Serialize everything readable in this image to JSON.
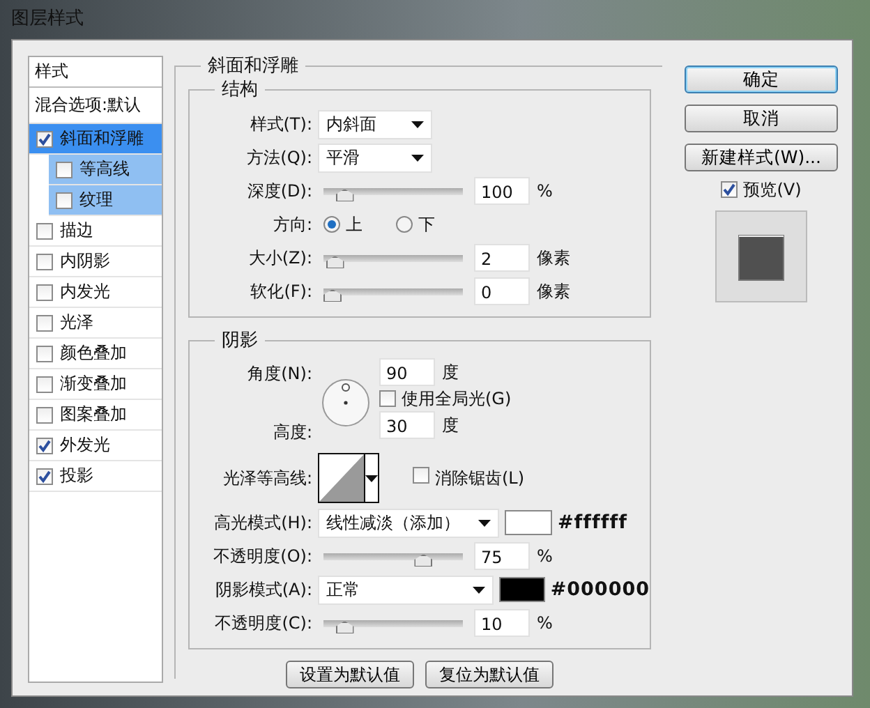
{
  "window": {
    "title": "图层样式"
  },
  "styles_panel": {
    "header": "样式",
    "blending_options": "混合选项:默认",
    "items": [
      {
        "label": "斜面和浮雕",
        "checked": true,
        "selected": true,
        "children": [
          {
            "label": "等高线",
            "checked": false,
            "selected": false
          },
          {
            "label": "纹理",
            "checked": false,
            "selected": false
          }
        ]
      },
      {
        "label": "描边",
        "checked": false,
        "selected": false
      },
      {
        "label": "内阴影",
        "checked": false,
        "selected": false
      },
      {
        "label": "内发光",
        "checked": false,
        "selected": false
      },
      {
        "label": "光泽",
        "checked": false,
        "selected": false
      },
      {
        "label": "颜色叠加",
        "checked": false,
        "selected": false
      },
      {
        "label": "渐变叠加",
        "checked": false,
        "selected": false
      },
      {
        "label": "图案叠加",
        "checked": false,
        "selected": false
      },
      {
        "label": "外发光",
        "checked": true,
        "selected": false
      },
      {
        "label": "投影",
        "checked": true,
        "selected": false
      }
    ]
  },
  "bevel": {
    "title": "斜面和浮雕",
    "structure": {
      "title": "结构",
      "rows": [
        {
          "kind": "select",
          "label": "样式(T):",
          "value": "内斜面"
        },
        {
          "kind": "select",
          "label": "方法(Q):",
          "value": "平滑"
        },
        {
          "kind": "slider",
          "label": "深度(D):",
          "level": 0.1,
          "value": "100",
          "unit": "%"
        },
        {
          "kind": "radio",
          "label": "方向:",
          "options": [
            {
              "label": "上",
              "selected": true
            },
            {
              "label": "下",
              "selected": false
            }
          ]
        },
        {
          "kind": "slider",
          "label": "大小(Z):",
          "level": 0.02,
          "value": "2",
          "unit": "像素"
        },
        {
          "kind": "slider",
          "label": "软化(F):",
          "level": 0,
          "value": "0",
          "unit": "像素"
        }
      ]
    },
    "shading": {
      "title": "阴影",
      "angle": {
        "label": "角度(N):",
        "value": "90",
        "unit": "度"
      },
      "global_light": {
        "label": "使用全局光(G)",
        "checked": false
      },
      "altitude": {
        "label": "高度:",
        "value": "30",
        "unit": "度"
      },
      "gloss_contour": {
        "label": "光泽等高线:"
      },
      "anti_aliased": {
        "label": "消除锯齿(L)",
        "checked": false
      },
      "rows": [
        {
          "kind": "mode",
          "label": "高光模式(H):",
          "value": "线性减淡（添加）",
          "color": "#ffffff",
          "color_text": "#ffffff"
        },
        {
          "kind": "slider",
          "label": "不透明度(O):",
          "level": 0.75,
          "value": "75",
          "unit": "%"
        },
        {
          "kind": "mode",
          "label": "阴影模式(A):",
          "value": "正常",
          "color": "#000000",
          "color_text": "#000000"
        },
        {
          "kind": "slider",
          "label": "不透明度(C):",
          "level": 0.1,
          "value": "10",
          "unit": "%"
        }
      ]
    },
    "buttons": [
      "设置为默认值",
      "复位为默认值"
    ]
  },
  "actions": [
    {
      "label": "确定",
      "default": true
    },
    {
      "label": "取消",
      "default": false
    },
    {
      "label": "新建样式(W)...",
      "default": false
    }
  ],
  "preview": {
    "label": "预览(V)",
    "checked": true
  }
}
